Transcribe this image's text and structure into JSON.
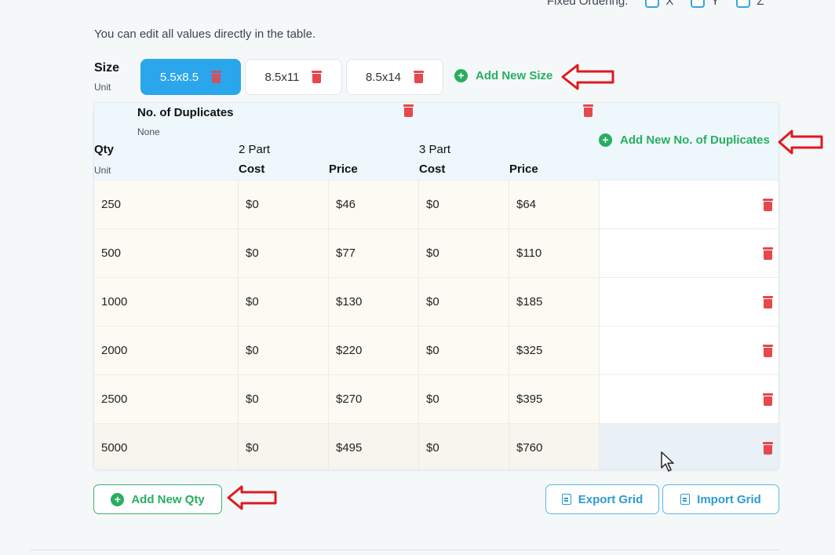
{
  "fixed_ordering": {
    "label": "Fixed Ordering:",
    "options": [
      "X",
      "Y",
      "Z"
    ]
  },
  "hint": "You can edit all values directly in the table.",
  "size": {
    "label": "Size",
    "unit": "Unit",
    "chips": [
      {
        "label": "5.5x8.5",
        "active": true
      },
      {
        "label": "8.5x11",
        "active": false
      },
      {
        "label": "8.5x14",
        "active": false
      }
    ],
    "add_label": "Add New Size"
  },
  "duplicates": {
    "label": "No. of Duplicates",
    "unit": "None",
    "add_label": "Add New No. of Duplicates",
    "groups": [
      "2 Part",
      "3 Part"
    ]
  },
  "qty": {
    "label": "Qty",
    "unit": "Unit"
  },
  "columns": [
    "Cost",
    "Price",
    "Cost",
    "Price"
  ],
  "rows": [
    {
      "qty": "250",
      "cost2": "$0",
      "price2": "$46",
      "cost3": "$0",
      "price3": "$64"
    },
    {
      "qty": "500",
      "cost2": "$0",
      "price2": "$77",
      "cost3": "$0",
      "price3": "$110"
    },
    {
      "qty": "1000",
      "cost2": "$0",
      "price2": "$130",
      "cost3": "$0",
      "price3": "$185"
    },
    {
      "qty": "2000",
      "cost2": "$0",
      "price2": "$220",
      "cost3": "$0",
      "price3": "$325"
    },
    {
      "qty": "2500",
      "cost2": "$0",
      "price2": "$270",
      "cost3": "$0",
      "price3": "$395"
    },
    {
      "qty": "5000",
      "cost2": "$0",
      "price2": "$495",
      "cost3": "$0",
      "price3": "$760"
    }
  ],
  "buttons": {
    "add_qty": "Add New Qty",
    "export": "Export Grid",
    "import": "Import Grid"
  },
  "colors": {
    "accent": "#2aa6ec",
    "green": "#27ae60",
    "delete": "#e5484d",
    "annotation": "#e0191f"
  }
}
